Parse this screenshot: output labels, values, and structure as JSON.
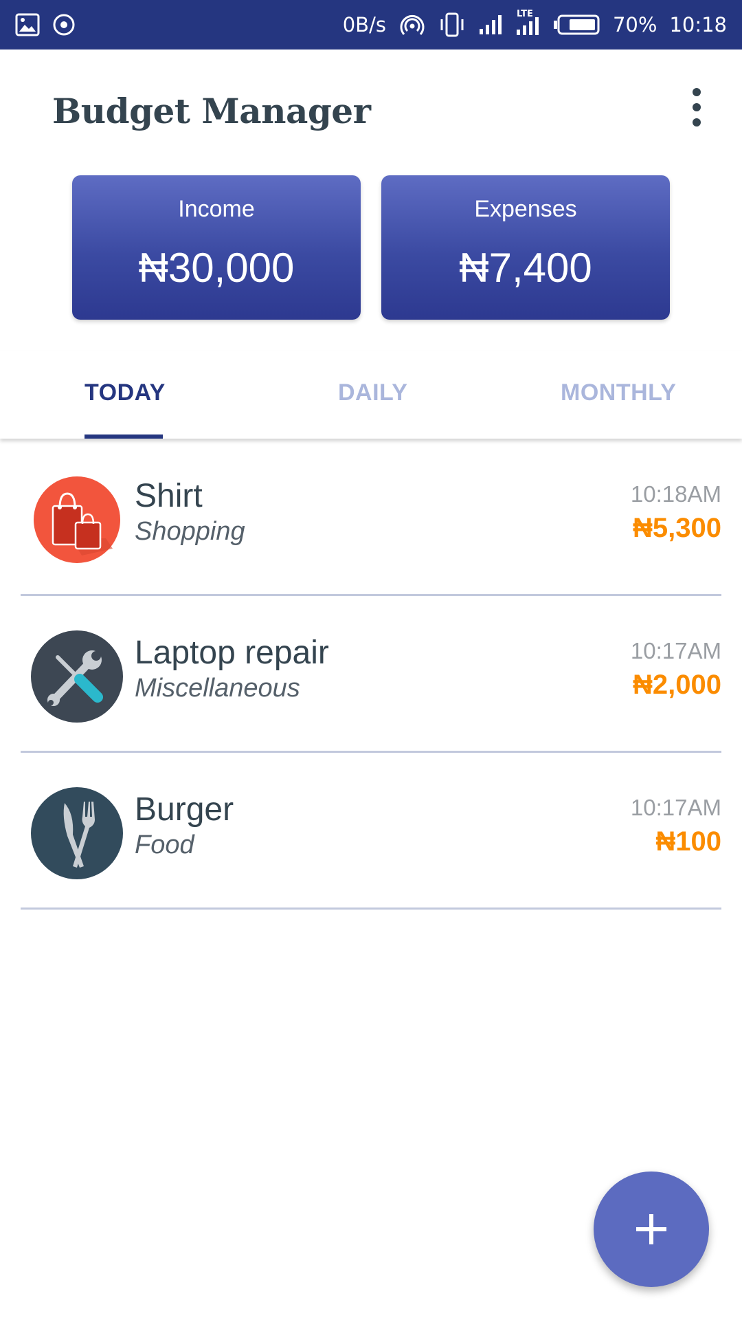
{
  "status_bar": {
    "network_speed": "0B/s",
    "network_type": "LTE",
    "battery": "70%",
    "time": "10:18",
    "icons": [
      "image-icon",
      "sync-icon",
      "hotspot-icon",
      "vibrate-icon",
      "signal-icon",
      "lte-signal-icon",
      "battery-icon"
    ]
  },
  "app": {
    "title": "Budget Manager",
    "menu_icon": "more-vert-icon"
  },
  "summary": {
    "income_label": "Income",
    "income_value": "₦30,000",
    "expenses_label": "Expenses",
    "expenses_value": "₦7,400"
  },
  "tabs": [
    {
      "label": "TODAY",
      "selected": true
    },
    {
      "label": "DAILY",
      "selected": false
    },
    {
      "label": "MONTHLY",
      "selected": false
    }
  ],
  "transactions": [
    {
      "title": "Shirt",
      "category": "Shopping",
      "time": "10:18AM",
      "amount": "₦5,300",
      "icon": "shopping-bag-icon"
    },
    {
      "title": "Laptop repair",
      "category": "Miscellaneous",
      "time": "10:17AM",
      "amount": "₦2,000",
      "icon": "tools-icon"
    },
    {
      "title": "Burger",
      "category": "Food",
      "time": "10:17AM",
      "amount": "₦100",
      "icon": "cutlery-icon"
    }
  ],
  "fab": {
    "icon": "plus-icon"
  },
  "colors": {
    "primary_dark": "#253680",
    "primary": "#3f51b5",
    "accent": "#5c6bc0",
    "amount": "#fb8c00",
    "text_dark": "#34444f"
  }
}
